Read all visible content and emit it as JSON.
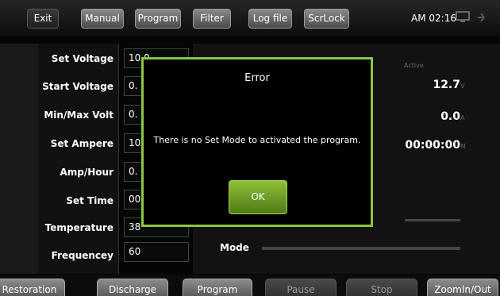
{
  "topbar": {
    "buttons": [
      "Exit",
      "Manual",
      "Program",
      "Filter",
      "Log file",
      "ScrLock"
    ],
    "clock": "AM 02:16"
  },
  "params": {
    "labels": [
      "Set Voltage",
      "Start Voltage",
      "Min/Max Volt",
      "Set Ampere",
      "Amp/Hour",
      "Set Time",
      "Temperature",
      "Frequencey"
    ],
    "values": [
      "10.0",
      "0.",
      "0.",
      "10",
      "0.",
      "00",
      "38",
      "60"
    ]
  },
  "readings": {
    "active_label": "Active",
    "voltage": "12.7",
    "voltage_unit": "V",
    "current": "0.0",
    "current_unit": "A",
    "time": "00:00:00",
    "time_unit": "M",
    "mode_label": "Mode"
  },
  "bottombar": {
    "buttons": [
      "Restoration",
      "Discharge",
      "Program",
      "Pause",
      "Stop",
      "ZoomIn/Out"
    ]
  },
  "dialog": {
    "title": "Error",
    "message": "There is no Set Mode to activated the program.",
    "ok_label": "OK"
  }
}
